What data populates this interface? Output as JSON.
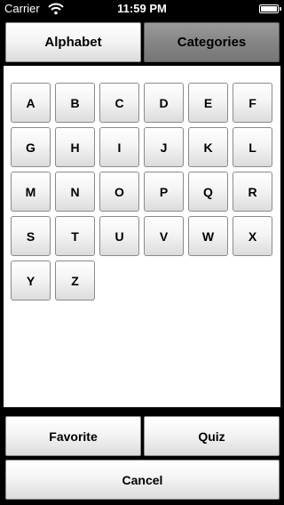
{
  "status_bar": {
    "carrier": "Carrier",
    "time": "11:59 PM",
    "battery_level": 1.0
  },
  "tabs": [
    {
      "label": "Alphabet",
      "selected": false
    },
    {
      "label": "Categories",
      "selected": true
    }
  ],
  "letters": [
    "A",
    "B",
    "C",
    "D",
    "E",
    "F",
    "G",
    "H",
    "I",
    "J",
    "K",
    "L",
    "M",
    "N",
    "O",
    "P",
    "Q",
    "R",
    "S",
    "T",
    "U",
    "V",
    "W",
    "X",
    "Y",
    "Z"
  ],
  "footer": {
    "favorite_label": "Favorite",
    "quiz_label": "Quiz",
    "cancel_label": "Cancel"
  }
}
